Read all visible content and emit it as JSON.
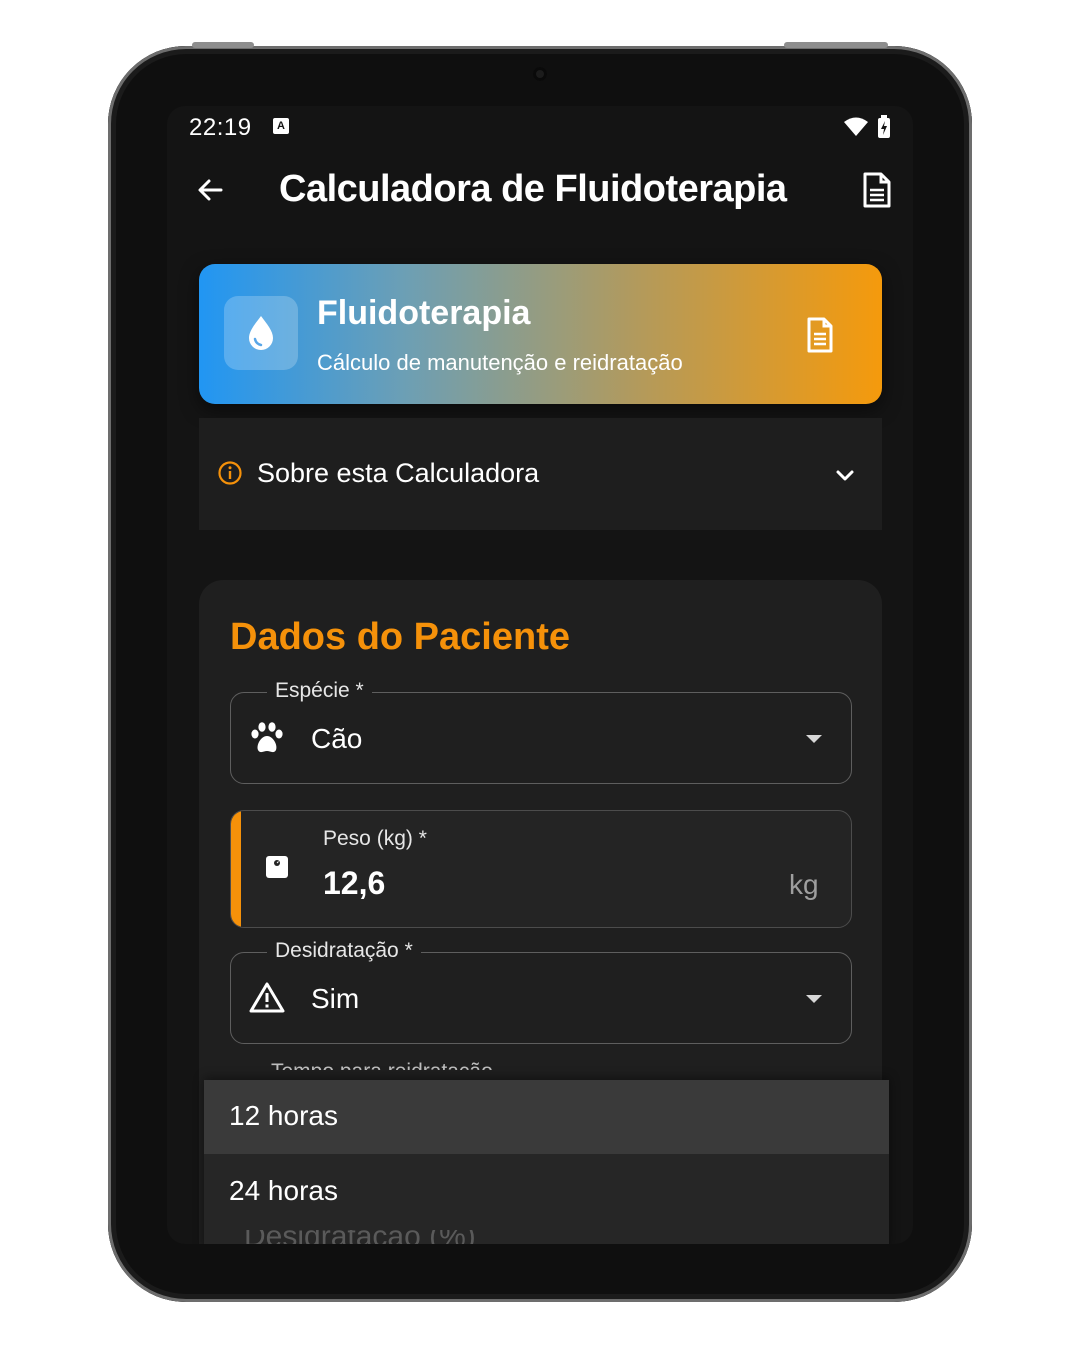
{
  "status_bar": {
    "time": "22:19",
    "notification_badge": "A"
  },
  "app_bar": {
    "title": "Calculadora de Fluidoterapia"
  },
  "hero": {
    "title": "Fluidoterapia",
    "subtitle": "Cálculo de manutenção e reidratação"
  },
  "about": {
    "label": "Sobre esta Calculadora"
  },
  "form": {
    "section_title": "Dados do Paciente",
    "species": {
      "label": "Espécie *",
      "value": "Cão"
    },
    "weight": {
      "label": "Peso (kg) *",
      "value": "12,6",
      "suffix": "kg"
    },
    "dehydration": {
      "label": "Desidratação *",
      "value": "Sim"
    },
    "next_field_label": "Tempo para reidratação"
  },
  "dropdown": {
    "options": [
      "12 horas",
      "24 horas"
    ],
    "selected": "12 horas",
    "underlying_field": "Desidratação (%)"
  },
  "colors": {
    "accent": "#f5910a",
    "gradient_start": "#2196f3",
    "gradient_end": "#f59a0c",
    "background": "#141414"
  },
  "icons": [
    "back-arrow-icon",
    "document-icon",
    "water-drop-icon",
    "info-icon",
    "chevron-down-icon",
    "paw-icon",
    "scale-icon",
    "warning-icon"
  ]
}
